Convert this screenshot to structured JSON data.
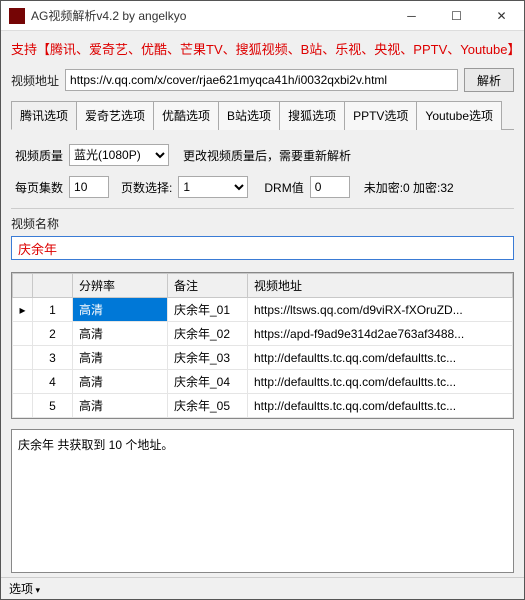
{
  "window": {
    "title": "AG视频解析v4.2 by angelkyo"
  },
  "support_text": "支持【腾讯、爱奇艺、优酷、芒果TV、搜狐视频、B站、乐视、央视、PPTV、Youtube】",
  "url_row": {
    "label": "视频地址",
    "value": "https://v.qq.com/x/cover/rjae621myqca41h/i0032qxbi2v.html",
    "parse_btn": "解析"
  },
  "tabs": [
    "腾讯选项",
    "爱奇艺选项",
    "优酷选项",
    "B站选项",
    "搜狐选项",
    "PPTV选项",
    "Youtube选项"
  ],
  "quality": {
    "label": "视频质量",
    "value": "蓝光(1080P)",
    "hint": "更改视频质量后，需要重新解析"
  },
  "paging": {
    "per_page_label": "每页集数",
    "per_page_value": "10",
    "page_sel_label": "页数选择:",
    "page_sel_value": "1",
    "drm_label": "DRM值",
    "drm_value": "0",
    "crypto_text": "未加密:0  加密:32"
  },
  "name_section": {
    "label": "视频名称",
    "value": "庆余年"
  },
  "table": {
    "headers": {
      "res": "分辨率",
      "note": "备注",
      "url": "视频地址"
    },
    "rows": [
      {
        "marker": "▸",
        "idx": "1",
        "res": "高清",
        "note": "庆余年_01",
        "url": "https://ltsws.qq.com/d9viRX-fXOruZD...",
        "selected": true
      },
      {
        "marker": "",
        "idx": "2",
        "res": "高清",
        "note": "庆余年_02",
        "url": "https://apd-f9ad9e314d2ae763af3488..."
      },
      {
        "marker": "",
        "idx": "3",
        "res": "高清",
        "note": "庆余年_03",
        "url": "http://defaultts.tc.qq.com/defaultts.tc..."
      },
      {
        "marker": "",
        "idx": "4",
        "res": "高清",
        "note": "庆余年_04",
        "url": "http://defaultts.tc.qq.com/defaultts.tc..."
      },
      {
        "marker": "",
        "idx": "5",
        "res": "高清",
        "note": "庆余年_05",
        "url": "http://defaultts.tc.qq.com/defaultts.tc..."
      }
    ]
  },
  "log_text": "庆余年 共获取到 10 个地址。",
  "status": {
    "options_label": "选项"
  }
}
